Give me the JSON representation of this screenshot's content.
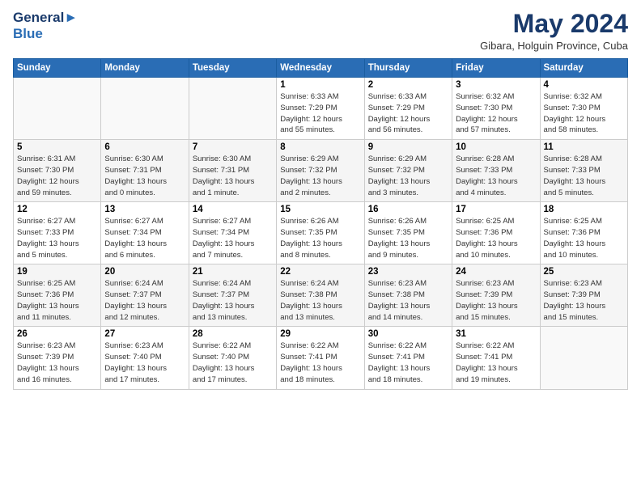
{
  "header": {
    "logo_line1": "General",
    "logo_line2": "Blue",
    "title": "May 2024",
    "location": "Gibara, Holguin Province, Cuba"
  },
  "weekdays": [
    "Sunday",
    "Monday",
    "Tuesday",
    "Wednesday",
    "Thursday",
    "Friday",
    "Saturday"
  ],
  "weeks": [
    [
      {
        "day": "",
        "info": ""
      },
      {
        "day": "",
        "info": ""
      },
      {
        "day": "",
        "info": ""
      },
      {
        "day": "1",
        "info": "Sunrise: 6:33 AM\nSunset: 7:29 PM\nDaylight: 12 hours\nand 55 minutes."
      },
      {
        "day": "2",
        "info": "Sunrise: 6:33 AM\nSunset: 7:29 PM\nDaylight: 12 hours\nand 56 minutes."
      },
      {
        "day": "3",
        "info": "Sunrise: 6:32 AM\nSunset: 7:30 PM\nDaylight: 12 hours\nand 57 minutes."
      },
      {
        "day": "4",
        "info": "Sunrise: 6:32 AM\nSunset: 7:30 PM\nDaylight: 12 hours\nand 58 minutes."
      }
    ],
    [
      {
        "day": "5",
        "info": "Sunrise: 6:31 AM\nSunset: 7:30 PM\nDaylight: 12 hours\nand 59 minutes."
      },
      {
        "day": "6",
        "info": "Sunrise: 6:30 AM\nSunset: 7:31 PM\nDaylight: 13 hours\nand 0 minutes."
      },
      {
        "day": "7",
        "info": "Sunrise: 6:30 AM\nSunset: 7:31 PM\nDaylight: 13 hours\nand 1 minute."
      },
      {
        "day": "8",
        "info": "Sunrise: 6:29 AM\nSunset: 7:32 PM\nDaylight: 13 hours\nand 2 minutes."
      },
      {
        "day": "9",
        "info": "Sunrise: 6:29 AM\nSunset: 7:32 PM\nDaylight: 13 hours\nand 3 minutes."
      },
      {
        "day": "10",
        "info": "Sunrise: 6:28 AM\nSunset: 7:33 PM\nDaylight: 13 hours\nand 4 minutes."
      },
      {
        "day": "11",
        "info": "Sunrise: 6:28 AM\nSunset: 7:33 PM\nDaylight: 13 hours\nand 5 minutes."
      }
    ],
    [
      {
        "day": "12",
        "info": "Sunrise: 6:27 AM\nSunset: 7:33 PM\nDaylight: 13 hours\nand 5 minutes."
      },
      {
        "day": "13",
        "info": "Sunrise: 6:27 AM\nSunset: 7:34 PM\nDaylight: 13 hours\nand 6 minutes."
      },
      {
        "day": "14",
        "info": "Sunrise: 6:27 AM\nSunset: 7:34 PM\nDaylight: 13 hours\nand 7 minutes."
      },
      {
        "day": "15",
        "info": "Sunrise: 6:26 AM\nSunset: 7:35 PM\nDaylight: 13 hours\nand 8 minutes."
      },
      {
        "day": "16",
        "info": "Sunrise: 6:26 AM\nSunset: 7:35 PM\nDaylight: 13 hours\nand 9 minutes."
      },
      {
        "day": "17",
        "info": "Sunrise: 6:25 AM\nSunset: 7:36 PM\nDaylight: 13 hours\nand 10 minutes."
      },
      {
        "day": "18",
        "info": "Sunrise: 6:25 AM\nSunset: 7:36 PM\nDaylight: 13 hours\nand 10 minutes."
      }
    ],
    [
      {
        "day": "19",
        "info": "Sunrise: 6:25 AM\nSunset: 7:36 PM\nDaylight: 13 hours\nand 11 minutes."
      },
      {
        "day": "20",
        "info": "Sunrise: 6:24 AM\nSunset: 7:37 PM\nDaylight: 13 hours\nand 12 minutes."
      },
      {
        "day": "21",
        "info": "Sunrise: 6:24 AM\nSunset: 7:37 PM\nDaylight: 13 hours\nand 13 minutes."
      },
      {
        "day": "22",
        "info": "Sunrise: 6:24 AM\nSunset: 7:38 PM\nDaylight: 13 hours\nand 13 minutes."
      },
      {
        "day": "23",
        "info": "Sunrise: 6:23 AM\nSunset: 7:38 PM\nDaylight: 13 hours\nand 14 minutes."
      },
      {
        "day": "24",
        "info": "Sunrise: 6:23 AM\nSunset: 7:39 PM\nDaylight: 13 hours\nand 15 minutes."
      },
      {
        "day": "25",
        "info": "Sunrise: 6:23 AM\nSunset: 7:39 PM\nDaylight: 13 hours\nand 15 minutes."
      }
    ],
    [
      {
        "day": "26",
        "info": "Sunrise: 6:23 AM\nSunset: 7:39 PM\nDaylight: 13 hours\nand 16 minutes."
      },
      {
        "day": "27",
        "info": "Sunrise: 6:23 AM\nSunset: 7:40 PM\nDaylight: 13 hours\nand 17 minutes."
      },
      {
        "day": "28",
        "info": "Sunrise: 6:22 AM\nSunset: 7:40 PM\nDaylight: 13 hours\nand 17 minutes."
      },
      {
        "day": "29",
        "info": "Sunrise: 6:22 AM\nSunset: 7:41 PM\nDaylight: 13 hours\nand 18 minutes."
      },
      {
        "day": "30",
        "info": "Sunrise: 6:22 AM\nSunset: 7:41 PM\nDaylight: 13 hours\nand 18 minutes."
      },
      {
        "day": "31",
        "info": "Sunrise: 6:22 AM\nSunset: 7:41 PM\nDaylight: 13 hours\nand 19 minutes."
      },
      {
        "day": "",
        "info": ""
      }
    ]
  ]
}
